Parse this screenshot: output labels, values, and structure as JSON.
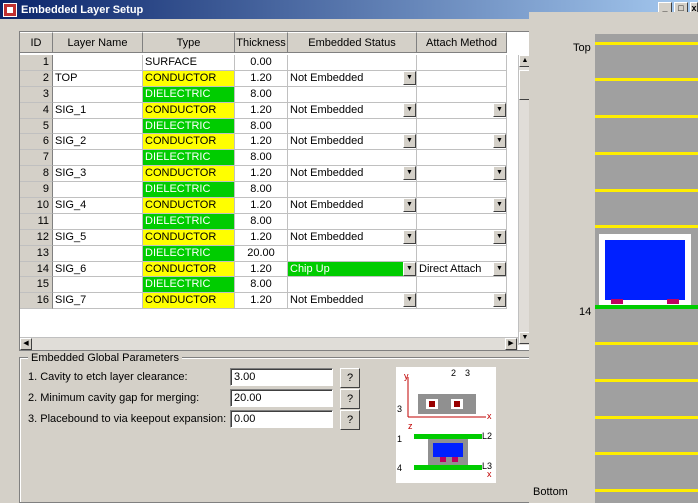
{
  "window": {
    "title": "Embedded Layer Setup"
  },
  "grid": {
    "headers": {
      "id": "ID",
      "name": "Layer Name",
      "type": "Type",
      "thickness": "Thickness",
      "embedded": "Embedded Status",
      "attach": "Attach Method"
    },
    "rows": [
      {
        "id": "1",
        "name": "",
        "type": "SURFACE",
        "thickness": "0.00",
        "embedded": "",
        "attach": ""
      },
      {
        "id": "2",
        "name": "TOP",
        "type": "CONDUCTOR",
        "thickness": "1.20",
        "embedded": "Not Embedded",
        "attach": ""
      },
      {
        "id": "3",
        "name": "",
        "type": "DIELECTRIC",
        "thickness": "8.00",
        "embedded": "",
        "attach": ""
      },
      {
        "id": "4",
        "name": "SIG_1",
        "type": "CONDUCTOR",
        "thickness": "1.20",
        "embedded": "Not Embedded",
        "attach": ""
      },
      {
        "id": "5",
        "name": "",
        "type": "DIELECTRIC",
        "thickness": "8.00",
        "embedded": "",
        "attach": ""
      },
      {
        "id": "6",
        "name": "SIG_2",
        "type": "CONDUCTOR",
        "thickness": "1.20",
        "embedded": "Not Embedded",
        "attach": ""
      },
      {
        "id": "7",
        "name": "",
        "type": "DIELECTRIC",
        "thickness": "8.00",
        "embedded": "",
        "attach": ""
      },
      {
        "id": "8",
        "name": "SIG_3",
        "type": "CONDUCTOR",
        "thickness": "1.20",
        "embedded": "Not Embedded",
        "attach": ""
      },
      {
        "id": "9",
        "name": "",
        "type": "DIELECTRIC",
        "thickness": "8.00",
        "embedded": "",
        "attach": ""
      },
      {
        "id": "10",
        "name": "SIG_4",
        "type": "CONDUCTOR",
        "thickness": "1.20",
        "embedded": "Not Embedded",
        "attach": ""
      },
      {
        "id": "11",
        "name": "",
        "type": "DIELECTRIC",
        "thickness": "8.00",
        "embedded": "",
        "attach": ""
      },
      {
        "id": "12",
        "name": "SIG_5",
        "type": "CONDUCTOR",
        "thickness": "1.20",
        "embedded": "Not Embedded",
        "attach": ""
      },
      {
        "id": "13",
        "name": "",
        "type": "DIELECTRIC",
        "thickness": "20.00",
        "embedded": "",
        "attach": ""
      },
      {
        "id": "14",
        "name": "SIG_6",
        "type": "CONDUCTOR",
        "thickness": "1.20",
        "embedded": "Chip Up",
        "attach": "Direct Attach"
      },
      {
        "id": "15",
        "name": "",
        "type": "DIELECTRIC",
        "thickness": "8.00",
        "embedded": "",
        "attach": ""
      },
      {
        "id": "16",
        "name": "SIG_7",
        "type": "CONDUCTOR",
        "thickness": "1.20",
        "embedded": "Not Embedded",
        "attach": ""
      }
    ]
  },
  "params": {
    "legend": "Embedded Global Parameters",
    "items": [
      {
        "label": "1. Cavity to etch layer clearance:",
        "value": "3.00",
        "help": "?"
      },
      {
        "label": "2. Minimum cavity gap for merging:",
        "value": "20.00",
        "help": "?"
      },
      {
        "label": "3. Placebound to via keepout expansion:",
        "value": "0.00",
        "help": "?"
      }
    ]
  },
  "diagram": {
    "n2": "2",
    "n3": "3",
    "n3b": "3",
    "n1": "1",
    "n4": "4",
    "l2": "L2",
    "l3": "L3",
    "y": "y",
    "x": "x",
    "z": "z"
  },
  "stack": {
    "top_label": "Top",
    "bottom_label": "Bottom",
    "layer_label": "14"
  },
  "colors": {
    "conductor": "#ffff00",
    "dielectric": "#00cc00",
    "chip": "#0020ff"
  }
}
